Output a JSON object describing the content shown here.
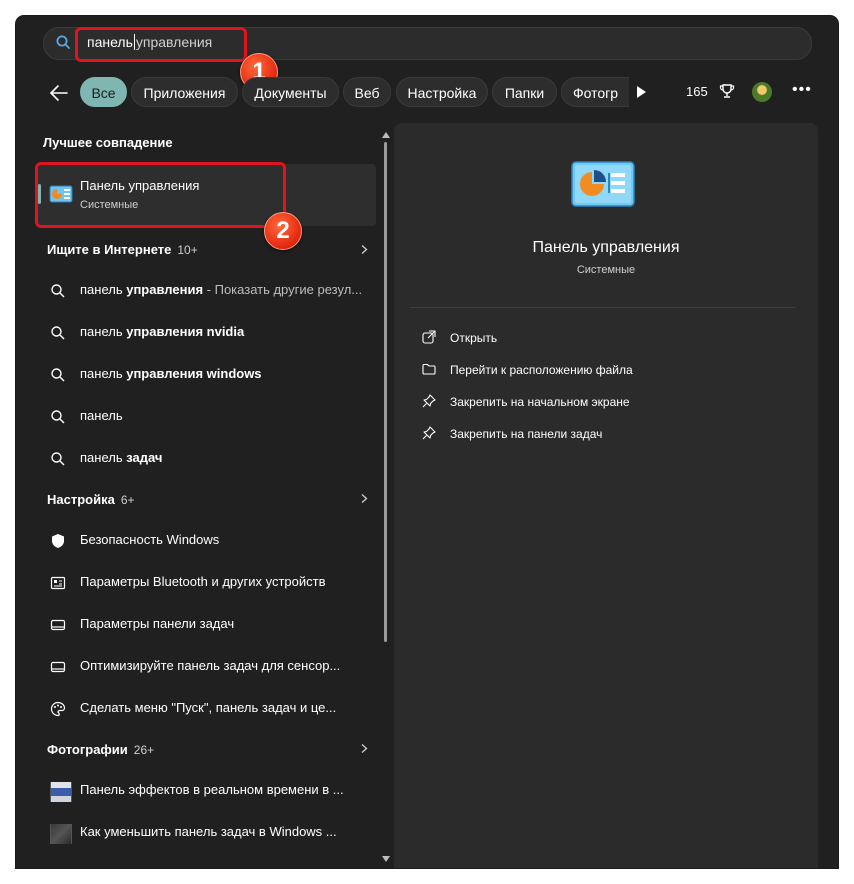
{
  "search": {
    "value_typed": "панель",
    "value_suggested": "управления"
  },
  "annotations": {
    "badge1": "1",
    "badge2": "2"
  },
  "filters": {
    "back_icon": "arrow-left-icon",
    "chips": [
      "Все",
      "Приложения",
      "Документы",
      "Веб",
      "Настройка",
      "Папки",
      "Фотогр"
    ],
    "points": "165"
  },
  "left": {
    "best_match_header": "Лучшее совпадение",
    "best_match": {
      "title": "Панель управления",
      "subtitle": "Системные"
    },
    "web": {
      "header": "Ищите в Интернете",
      "count": "10+",
      "items": [
        {
          "prefix": "панель ",
          "bold": "управления",
          "suffix": " - Показать другие резул..."
        },
        {
          "prefix": "панель ",
          "bold": "управления nvidia",
          "suffix": ""
        },
        {
          "prefix": "панель ",
          "bold": "управления windows",
          "suffix": ""
        },
        {
          "prefix": "панель",
          "bold": "",
          "suffix": ""
        },
        {
          "prefix": "панель ",
          "bold": "задач",
          "suffix": ""
        }
      ]
    },
    "settings": {
      "header": "Настройка",
      "count": "6+",
      "items": [
        "Безопасность Windows",
        "Параметры Bluetooth и других устройств",
        "Параметры панели задач",
        "Оптимизируйте панель задач для сенсор...",
        "Сделать меню \"Пуск\", панель задач и це..."
      ]
    },
    "photos": {
      "header": "Фотографии",
      "count": "26+",
      "items": [
        "Панель эффектов в реальном времени в ...",
        "Как уменьшить панель задач в Windows ..."
      ]
    }
  },
  "right": {
    "title": "Панель управления",
    "subtitle": "Системные",
    "actions": [
      "Открыть",
      "Перейти к расположению файла",
      "Закрепить на начальном экране",
      "Закрепить на панели задач"
    ]
  },
  "colors": {
    "accent": "#7fb6b1",
    "annotation_red": "#e0141e",
    "panel_bg": "#202020",
    "pane_bg": "#2b2b2b"
  }
}
